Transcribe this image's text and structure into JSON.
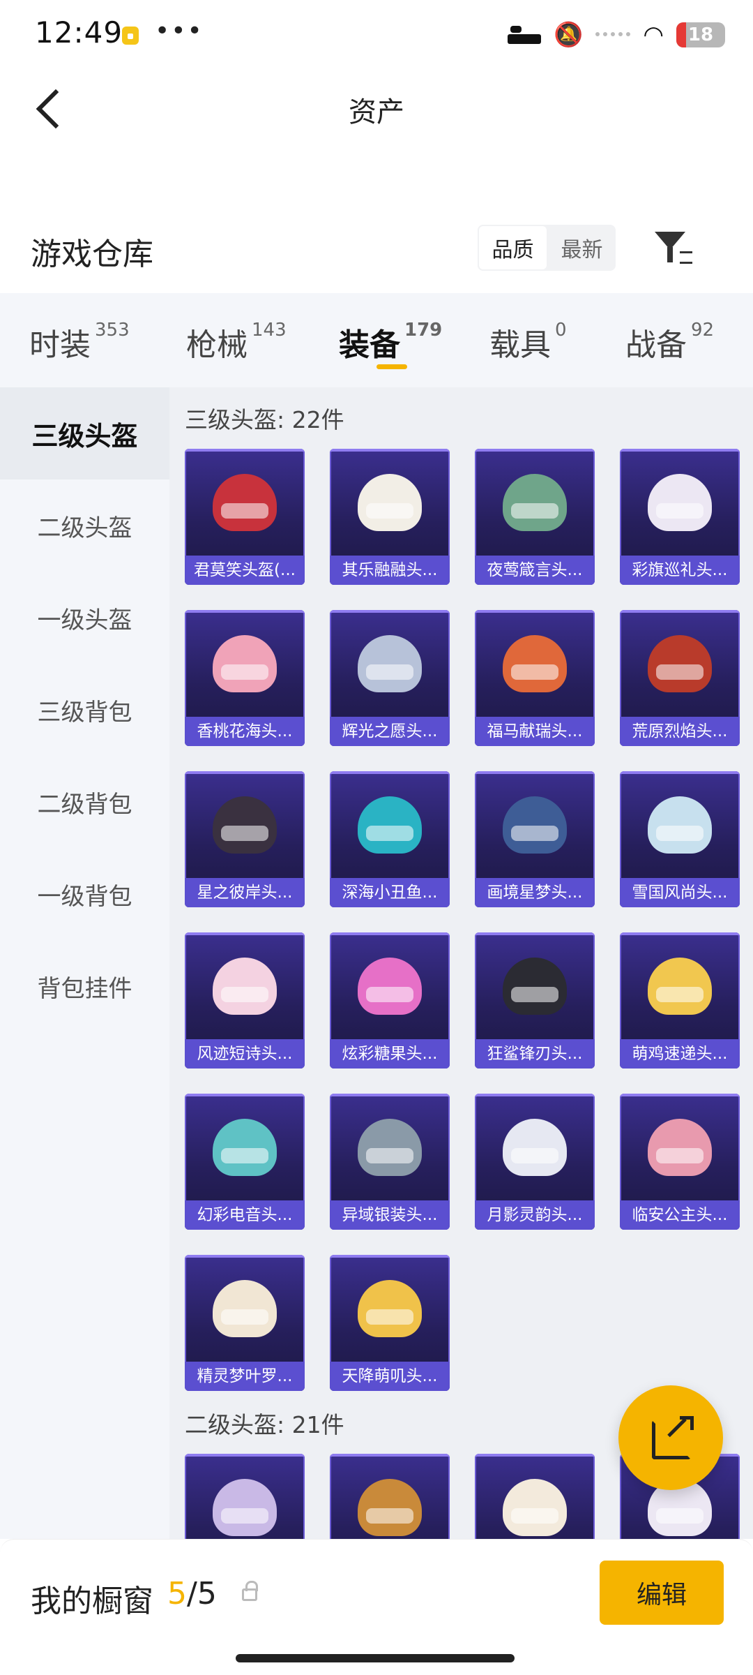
{
  "status_bar": {
    "time": "12:49",
    "dots": "•••",
    "battery": "18",
    "icons": [
      "lock-icon",
      "bed-icon",
      "mute-icon",
      "wifi-icon",
      "battery-icon"
    ]
  },
  "header": {
    "title": "资产"
  },
  "warehouse": {
    "title": "游戏仓库",
    "sort_options": [
      "品质",
      "最新"
    ],
    "active_sort": "品质"
  },
  "tabs": [
    {
      "label": "时装",
      "count": "353"
    },
    {
      "label": "枪械",
      "count": "143"
    },
    {
      "label": "装备",
      "count": "179",
      "active": true
    },
    {
      "label": "载具",
      "count": "0"
    },
    {
      "label": "战备",
      "count": "92"
    }
  ],
  "sidebar": {
    "items": [
      "三级头盔",
      "二级头盔",
      "一级头盔",
      "三级背包",
      "二级背包",
      "一级背包",
      "背包挂件"
    ],
    "active": "三级头盔"
  },
  "sections": [
    {
      "title": "三级头盔: 22件",
      "items": [
        {
          "label": "君莫笑头盔(...",
          "color": "#c8323c"
        },
        {
          "label": "其乐融融头...",
          "color": "#f2eee6"
        },
        {
          "label": "夜莺箴言头...",
          "color": "#6fa58a"
        },
        {
          "label": "彩旗巡礼头...",
          "color": "#ece7f3"
        },
        {
          "label": "香桃花海头...",
          "color": "#f0a3b8"
        },
        {
          "label": "辉光之愿头...",
          "color": "#b7c2d9"
        },
        {
          "label": "福马献瑞头...",
          "color": "#e0683a"
        },
        {
          "label": "荒原烈焰头...",
          "color": "#b93b2b"
        },
        {
          "label": "星之彼岸头...",
          "color": "#3a3140"
        },
        {
          "label": "深海小丑鱼...",
          "color": "#2ab3c4"
        },
        {
          "label": "画境星梦头...",
          "color": "#3e5d96"
        },
        {
          "label": "雪国风尚头...",
          "color": "#c7e0ee"
        },
        {
          "label": "风迹短诗头...",
          "color": "#f4d2e1"
        },
        {
          "label": "炫彩糖果头...",
          "color": "#e670c7"
        },
        {
          "label": "狂鲨锋刃头...",
          "color": "#2b2b33"
        },
        {
          "label": "萌鸡速递头...",
          "color": "#f1c74f"
        },
        {
          "label": "幻彩电音头...",
          "color": "#5fc2c5"
        },
        {
          "label": "异域银装头...",
          "color": "#8a9aa8"
        },
        {
          "label": "月影灵韵头...",
          "color": "#e6e8f2"
        },
        {
          "label": "临安公主头...",
          "color": "#e89aae"
        },
        {
          "label": "精灵梦叶罗...",
          "color": "#f1e6d4"
        },
        {
          "label": "天降萌叽头...",
          "color": "#f0c24a"
        }
      ]
    },
    {
      "title": "二级头盔: 21件",
      "items": [
        {
          "label": "",
          "color": "#c9b9e6"
        },
        {
          "label": "",
          "color": "#c98a3a"
        },
        {
          "label": "",
          "color": "#f3eadc"
        },
        {
          "label": "",
          "color": "#ece7f3"
        }
      ]
    }
  ],
  "fab": {
    "icon": "share-out-icon"
  },
  "bottom_bar": {
    "label": "我的橱窗",
    "count_num": "5",
    "count_total": "/5",
    "edit_label": "编辑"
  },
  "colors": {
    "accent": "#f5b400",
    "card_top": "#3b2f8f",
    "card_label": "#5b4fd0"
  }
}
